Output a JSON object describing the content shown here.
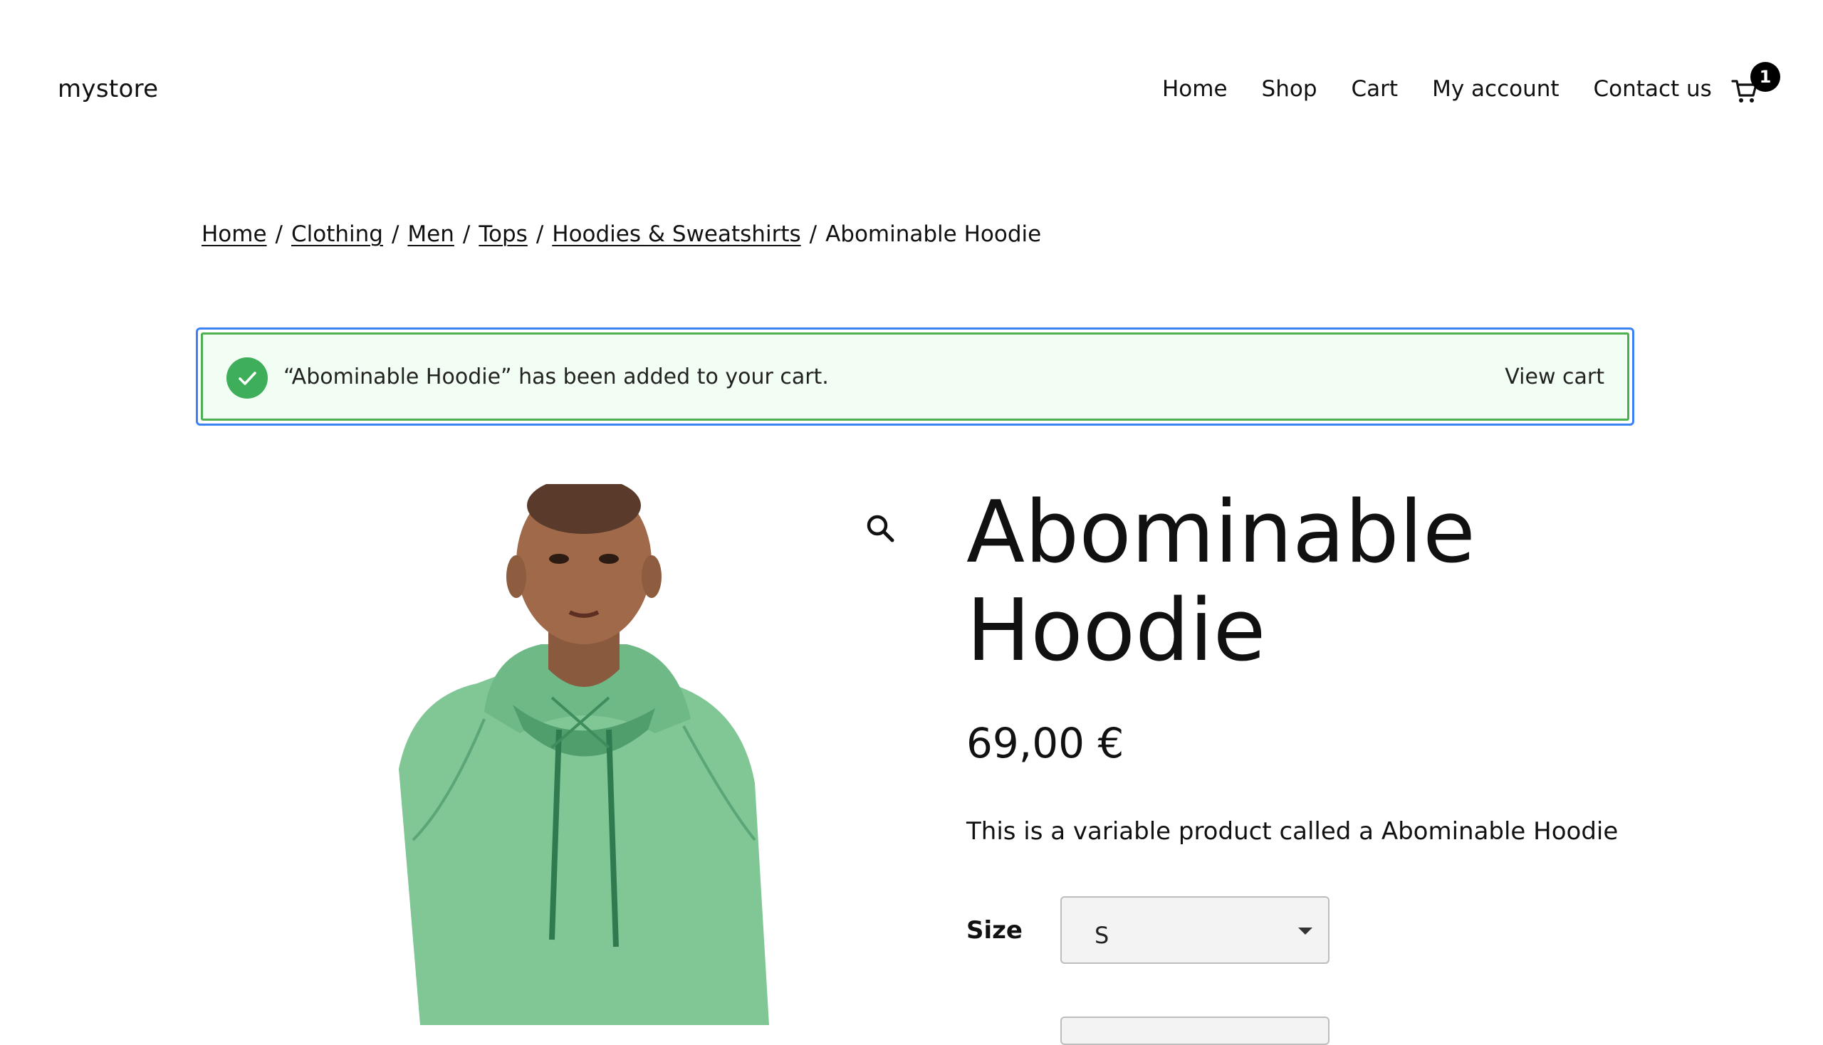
{
  "header": {
    "site_title": "mystore",
    "nav": {
      "home": "Home",
      "shop": "Shop",
      "cart": "Cart",
      "my_account": "My account",
      "contact": "Contact us"
    },
    "cart_count": "1",
    "cart_icon": "shopping-cart-icon"
  },
  "breadcrumb": {
    "items": [
      "Home",
      "Clothing",
      "Men",
      "Tops",
      "Hoodies & Sweatshirts"
    ],
    "separator": "/",
    "current": "Abominable Hoodie"
  },
  "notice": {
    "message": "“Abominable Hoodie” has been added to your cart.",
    "link": "View cart",
    "icon": "check-circle-icon"
  },
  "product": {
    "title": "Abominable Hoodie",
    "price": "69,00 €",
    "description": "This is a variable product called a Abominable Hoodie",
    "size_label": "Size",
    "size_value": "S",
    "zoom_icon": "magnifier-icon"
  },
  "colors": {
    "notice_bg": "#f2fdf3",
    "notice_border": "#4caf50",
    "check_green": "#3fae5a",
    "focus_blue": "#3b82f6",
    "hoodie_green": "#7cc590"
  }
}
